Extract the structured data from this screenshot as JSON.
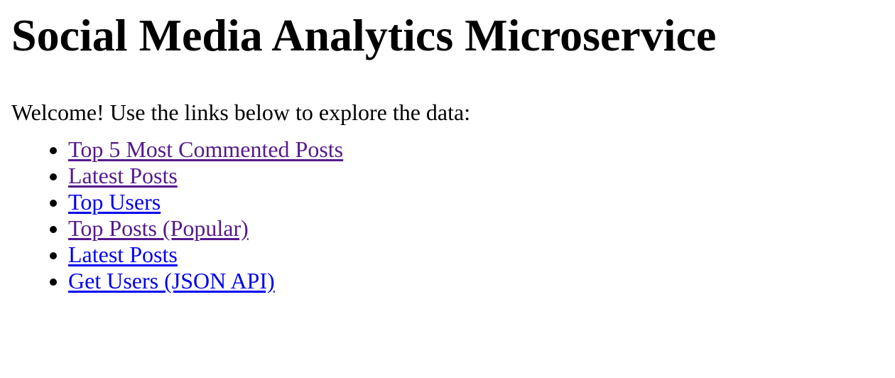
{
  "page": {
    "title": "Social Media Analytics Microservice",
    "intro": "Welcome! Use the links below to explore the data:"
  },
  "links": [
    {
      "label": "Top 5 Most Commented Posts",
      "state": "visited"
    },
    {
      "label": "Latest Posts",
      "state": "visited"
    },
    {
      "label": "Top Users",
      "state": "unvisited"
    },
    {
      "label": "Top Posts (Popular)",
      "state": "visited"
    },
    {
      "label": "Latest Posts",
      "state": "unvisited"
    },
    {
      "label": "Get Users (JSON API)",
      "state": "unvisited"
    }
  ],
  "colors": {
    "visited_link": "#551a8b",
    "unvisited_link": "#0000ee",
    "text": "#000000",
    "background": "#ffffff"
  }
}
